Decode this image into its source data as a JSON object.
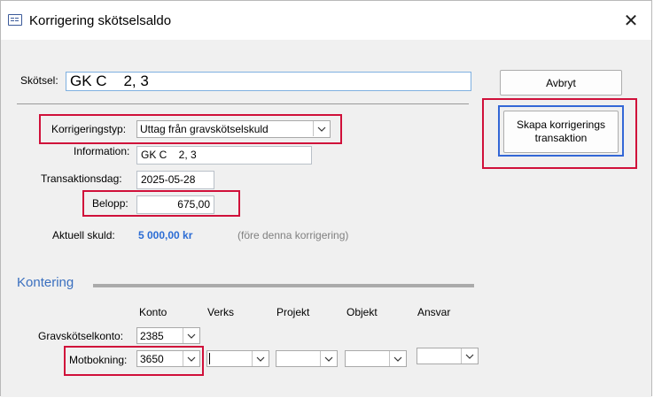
{
  "window": {
    "title": "Korrigering skötselsaldo",
    "close": "✕"
  },
  "skotsel": {
    "label": "Skötsel:",
    "value": "GK C    2, 3"
  },
  "buttons": {
    "avbryt": "Avbryt",
    "skapa_line1": "Skapa korrigerings",
    "skapa_line2": "transaktion"
  },
  "form": {
    "korrigeringstyp_label": "Korrigeringstyp:",
    "korrigeringstyp_value": "Uttag från gravskötselskuld",
    "information_label": "Information:",
    "information_value": "GK C    2, 3",
    "transaktionsdag_label": "Transaktionsdag:",
    "transaktionsdag_value": "2025-05-28",
    "belopp_label": "Belopp:",
    "belopp_value": "675,00",
    "aktuell_skuld_label": "Aktuell skuld:",
    "aktuell_skuld_value": "5 000,00 kr",
    "aktuell_skuld_note": "(före denna korrigering)"
  },
  "kontering": {
    "heading": "Kontering",
    "columns": [
      "Konto",
      "Verks",
      "Projekt",
      "Objekt",
      "Ansvar"
    ],
    "gravskotselkonto_label": "Gravskötselkonto:",
    "gravskotselkonto_value": "2385",
    "motbokning_label": "Motbokning:",
    "motbokning_value": "3650"
  },
  "colors": {
    "highlight_red": "#d0103a",
    "highlight_blue": "#3367d6",
    "skuld_blue": "#2b6cd4",
    "kontering_blue": "#3a6fbf"
  },
  "icons": [
    "app-form-icon",
    "close-icon",
    "chevron-down-icon"
  ]
}
